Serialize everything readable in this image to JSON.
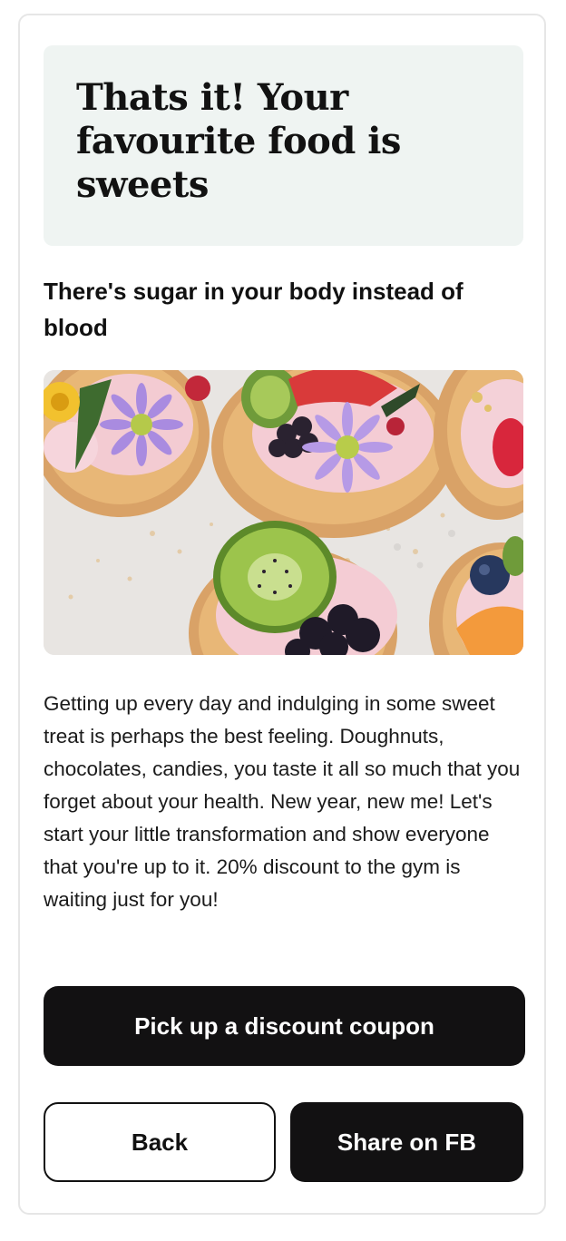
{
  "result": {
    "title": "Thats it! Your favourite food is sweets",
    "subtitle": "There's sugar in your body instead of blood",
    "image_alt": "Cookies decorated with cream, fruit and flowers",
    "description": "Getting up every day and indulging in some sweet treat is perhaps the best feeling. Doughnuts, chocolates, candies, you taste it all so much that you forget about your health. New year, new me! Let's start your little transformation and show everyone that you're up to it. 20% discount to the gym is waiting just for you!"
  },
  "actions": {
    "coupon_label": "Pick up a discount coupon",
    "back_label": "Back",
    "share_label": "Share on FB"
  },
  "colors": {
    "title_box_bg": "#eff4f2",
    "button_dark": "#121112",
    "text": "#111111"
  }
}
